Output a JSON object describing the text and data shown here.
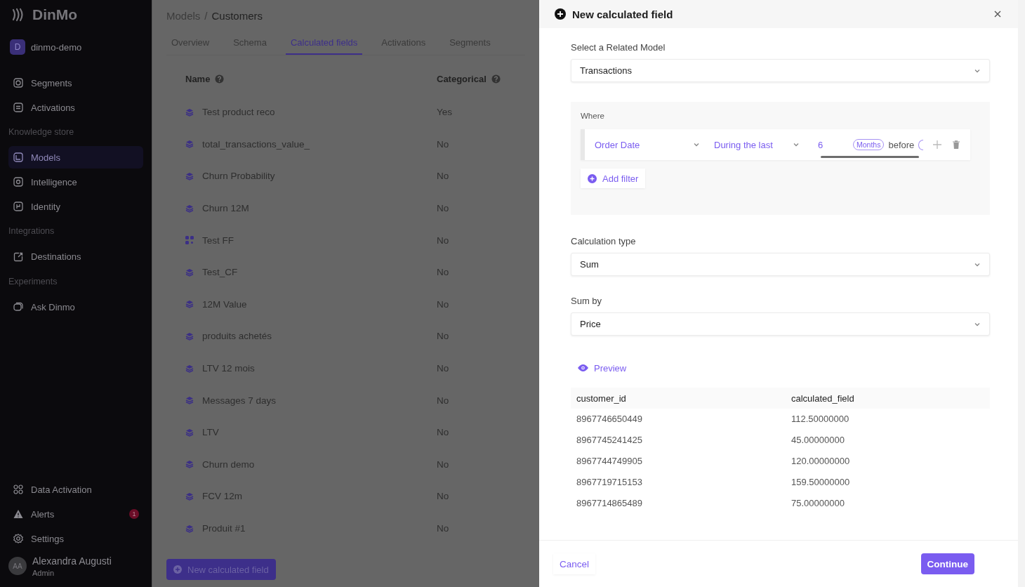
{
  "sidebar": {
    "logo": "DinMo",
    "workspace": {
      "initial": "D",
      "name": "dinmo-demo"
    },
    "items": [
      {
        "kind": "item",
        "label": "Segments",
        "selected": false
      },
      {
        "kind": "item",
        "label": "Activations",
        "selected": false
      },
      {
        "kind": "section",
        "label": "Knowledge store"
      },
      {
        "kind": "item",
        "label": "Models",
        "selected": true
      },
      {
        "kind": "item",
        "label": "Intelligence",
        "selected": false
      },
      {
        "kind": "item",
        "label": "Identity",
        "selected": false
      },
      {
        "kind": "section",
        "label": "Integrations"
      },
      {
        "kind": "item",
        "label": "Destinations",
        "selected": false
      },
      {
        "kind": "section",
        "label": "Experiments"
      },
      {
        "kind": "item",
        "label": "Ask Dinmo",
        "selected": false
      }
    ],
    "bottom_items": [
      {
        "label": "Data Activation"
      },
      {
        "label": "Alerts",
        "badge": "1"
      },
      {
        "label": "Settings"
      }
    ],
    "user": {
      "initials": "AA",
      "name": "Alexandra Augusti",
      "role": "Admin"
    }
  },
  "breadcrumb": [
    "Models",
    "/",
    "Customers"
  ],
  "tabs": [
    {
      "label": "Overview",
      "selected": false
    },
    {
      "label": "Schema",
      "selected": false
    },
    {
      "label": "Calculated fields",
      "selected": true
    },
    {
      "label": "Activations",
      "selected": false
    },
    {
      "label": "Segments",
      "selected": false
    }
  ],
  "table": {
    "columns": [
      "Name",
      "Categorical"
    ],
    "rows": [
      {
        "kind": "stack",
        "name": "Test product reco",
        "categorical": "Yes"
      },
      {
        "kind": "stack",
        "name": "total_transactions_value_",
        "categorical": "No"
      },
      {
        "kind": "stack",
        "name": "Churn Probability",
        "categorical": "No"
      },
      {
        "kind": "stack",
        "name": "Churn 12M",
        "categorical": "No"
      },
      {
        "kind": "grid",
        "name": "Test FF",
        "categorical": "No"
      },
      {
        "kind": "stack",
        "name": "Test_CF",
        "categorical": "No"
      },
      {
        "kind": "stack",
        "name": "12M Value",
        "categorical": "No"
      },
      {
        "kind": "stack",
        "name": "produits achetés",
        "categorical": "No"
      },
      {
        "kind": "stack",
        "name": "LTV 12 mois",
        "categorical": "No"
      },
      {
        "kind": "stack",
        "name": "Messages 7 days",
        "categorical": "No"
      },
      {
        "kind": "stack",
        "name": "LTV",
        "categorical": "No"
      },
      {
        "kind": "stack",
        "name": "Churn demo",
        "categorical": "No"
      },
      {
        "kind": "stack",
        "name": "FCV 12m",
        "categorical": "No"
      },
      {
        "kind": "stack",
        "name": "Produit #1",
        "categorical": "No"
      }
    ]
  },
  "new_button": "New calculated field",
  "drawer": {
    "title": "New calculated field",
    "related_model": {
      "label": "Select a Related Model",
      "value": "Transactions"
    },
    "where": {
      "label": "Where",
      "filter": {
        "field": "Order Date",
        "operator": "During the last",
        "value": "6",
        "unit": "Months",
        "relation": "before"
      },
      "add_filter": "Add filter"
    },
    "calculation_type": {
      "label": "Calculation type",
      "value": "Sum"
    },
    "sum_by": {
      "label": "Sum by",
      "value": "Price"
    },
    "preview": "Preview",
    "preview_table": {
      "columns": [
        "customer_id",
        "calculated_field"
      ],
      "rows": [
        [
          "8967746650449",
          "112.50000000"
        ],
        [
          "8967745241425",
          "45.00000000"
        ],
        [
          "8967744749905",
          "120.00000000"
        ],
        [
          "8967719715153",
          "159.50000000"
        ],
        [
          "8967714865489",
          "75.00000000"
        ]
      ]
    },
    "cancel": "Cancel",
    "continue": "Continue"
  }
}
